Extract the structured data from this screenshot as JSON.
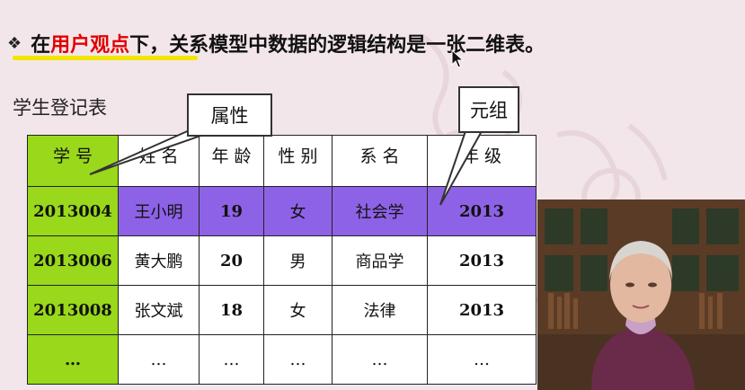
{
  "headline": {
    "bullet": "❖",
    "part1": "在",
    "highlight": "用户观点",
    "part2": "下，关系模型中数据的逻辑结构是一张二维表。"
  },
  "table_title": "学生登记表",
  "callouts": {
    "attribute": "属性",
    "tuple": "元组"
  },
  "table": {
    "headers": [
      "学 号",
      "姓 名",
      "年 龄",
      "性 别",
      "系 名",
      "年 级"
    ],
    "rows": [
      [
        "2013004",
        "王小明",
        "19",
        "女",
        "社会学",
        "2013"
      ],
      [
        "2013006",
        "黄大鹏",
        "20",
        "男",
        "商品学",
        "2013"
      ],
      [
        "2013008",
        "张文斌",
        "18",
        "女",
        "法律",
        "2013"
      ],
      [
        "…",
        "…",
        "…",
        "…",
        "…",
        "…"
      ]
    ],
    "highlighted_row": 0
  },
  "colors": {
    "key_column": "#99d81a",
    "highlight_row": "#8e62e6",
    "highlight_text": "#e00000",
    "underline": "#f2e600"
  }
}
